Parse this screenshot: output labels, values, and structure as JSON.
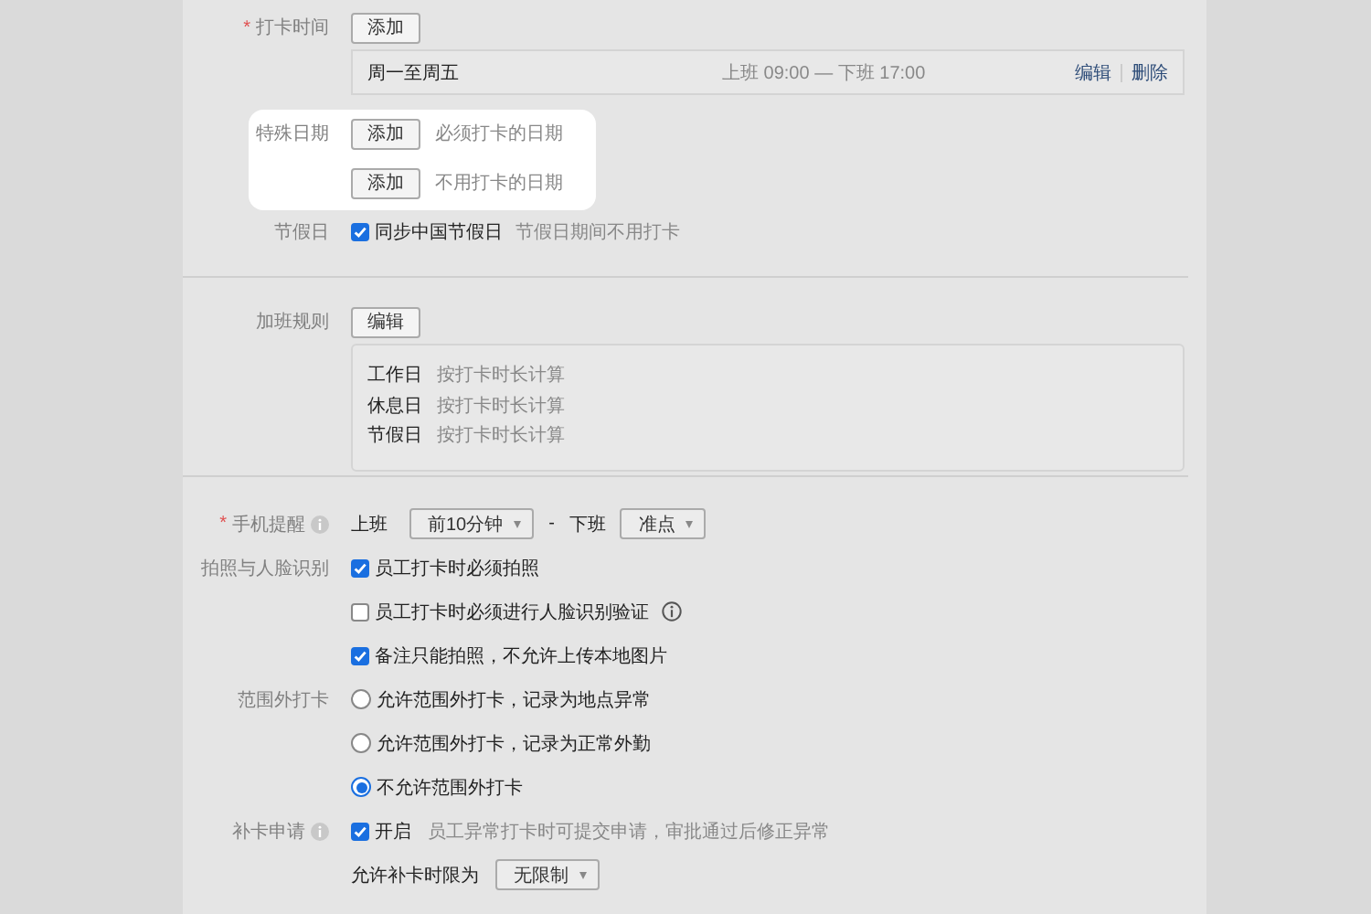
{
  "punch_time": {
    "label": "打卡时间",
    "required_mark": "*",
    "add_button": "添加",
    "schedule": {
      "days": "周一至周五",
      "hours": "上班 09:00 — 下班 17:00",
      "actions": [
        "编辑",
        "删除"
      ]
    }
  },
  "special_dates": {
    "label": "特殊日期",
    "highlighted": true,
    "rows": [
      {
        "button": "添加",
        "hint": "必须打卡的日期"
      },
      {
        "button": "添加",
        "hint": "不用打卡的日期"
      }
    ]
  },
  "holidays": {
    "label": "节假日",
    "option": {
      "label": "同步中国节假日",
      "checked": true
    },
    "hint": "节假日期间不用打卡"
  },
  "overtime": {
    "label": "加班规则",
    "edit_button": "编辑",
    "rules": [
      {
        "day": "工作日",
        "method": "按打卡时长计算"
      },
      {
        "day": "休息日",
        "method": "按打卡时长计算"
      },
      {
        "day": "节假日",
        "method": "按打卡时长计算"
      }
    ]
  },
  "reminder": {
    "label": "手机提醒",
    "required_mark": "*",
    "info": true,
    "start_label": "上班",
    "start_value": "前10分钟",
    "separator": "-",
    "end_label": "下班",
    "end_value": "准点"
  },
  "photo": {
    "label": "拍照与人脸识别",
    "options": [
      {
        "label": "员工打卡时必须拍照",
        "checked": true,
        "info": false
      },
      {
        "label": "员工打卡时必须进行人脸识别验证",
        "checked": false,
        "info": true
      },
      {
        "label": "备注只能拍照，不允许上传本地图片",
        "checked": true,
        "info": false
      }
    ]
  },
  "out_of_range": {
    "label": "范围外打卡",
    "options": [
      {
        "label": "允许范围外打卡，记录为地点异常",
        "selected": false
      },
      {
        "label": "允许范围外打卡，记录为正常外勤",
        "selected": false
      },
      {
        "label": "不允许范围外打卡",
        "selected": true
      }
    ]
  },
  "makeup": {
    "label": "补卡申请",
    "info": true,
    "option": {
      "label": "开启",
      "checked": true
    },
    "hint": "员工异常打卡时可提交申请，审批通过后修正异常",
    "limit_label": "允许补卡时限为",
    "limit_value": "无限制"
  }
}
